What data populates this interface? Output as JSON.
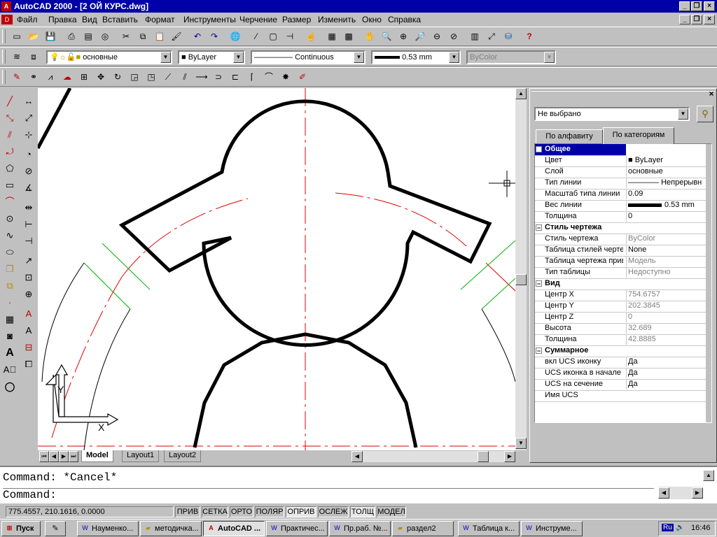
{
  "window": {
    "title": "AutoCAD 2000 - [2 ОЙ КУРС.dwg]"
  },
  "menu": [
    "Файл",
    "Правка",
    "Вид",
    "Вставить",
    "Формат",
    "Инструменты",
    "Черчение",
    "Размер",
    "Изменить",
    "Окно",
    "Справка"
  ],
  "layer_bar": {
    "layer": "основные",
    "color": "ByLayer",
    "linetype": "Continuous",
    "lineweight": "0.53 mm",
    "plotstyle": "ByColor"
  },
  "layout_tabs": [
    "Model",
    "Layout1",
    "Layout2"
  ],
  "properties": {
    "selection": "Не выбрано",
    "tabs": [
      "По алфавиту",
      "По категориям"
    ],
    "rows": [
      {
        "type": "cat",
        "label": "Общее"
      },
      {
        "label": "Цвет",
        "value": "ByLayer"
      },
      {
        "label": "Слой",
        "value": "основные"
      },
      {
        "label": "Тип линии",
        "value": "Непрерывн"
      },
      {
        "label": "Масштаб типа линии",
        "value": "0.09"
      },
      {
        "label": "Вес линии",
        "value": "0.53 mm"
      },
      {
        "label": "Толщина",
        "value": "0"
      },
      {
        "type": "cat",
        "label": "Стиль чертежа"
      },
      {
        "label": "Стиль чертежа",
        "value": "ByColor"
      },
      {
        "label": "Таблица стилей черте",
        "value": "None"
      },
      {
        "label": "Таблица чертежа прив",
        "value": "Модель"
      },
      {
        "label": "Тип таблицы",
        "value": "Недоступно"
      },
      {
        "type": "cat",
        "label": "Вид"
      },
      {
        "label": "Центр X",
        "value": "754.6757"
      },
      {
        "label": "Центр Y",
        "value": "202.3845"
      },
      {
        "label": "Центр Z",
        "value": "0"
      },
      {
        "label": "Высота",
        "value": "32.689"
      },
      {
        "label": "Толщина",
        "value": "42.8885"
      },
      {
        "type": "cat",
        "label": "Суммарное"
      },
      {
        "label": "вкл UCS иконку",
        "value": "Да"
      },
      {
        "label": "UCS иконка в начале",
        "value": "Да"
      },
      {
        "label": "UCS на сечение",
        "value": "Да"
      },
      {
        "label": "Имя UCS",
        "value": ""
      }
    ]
  },
  "command": {
    "history": "Command: *Cancel*",
    "prompt": "Command:"
  },
  "status": {
    "coords": "775.4557, 210.1616, 0.0000",
    "modes": [
      "ПРИВ",
      "СЕТКА",
      "ОРТО",
      "ПОЛЯР",
      "ОПРИВ",
      "ОСЛЕЖ",
      "ТОЛЩ",
      "МОДЕЛ"
    ]
  },
  "taskbar": {
    "start": "Пуск",
    "tasks": [
      "Науменко...",
      "методичка...",
      "AutoCAD ...",
      "Практичес...",
      "Пр.раб. №...",
      "раздел2",
      "Таблица к...",
      "Инструме..."
    ],
    "lang": "Ru",
    "clock": "16:46"
  }
}
